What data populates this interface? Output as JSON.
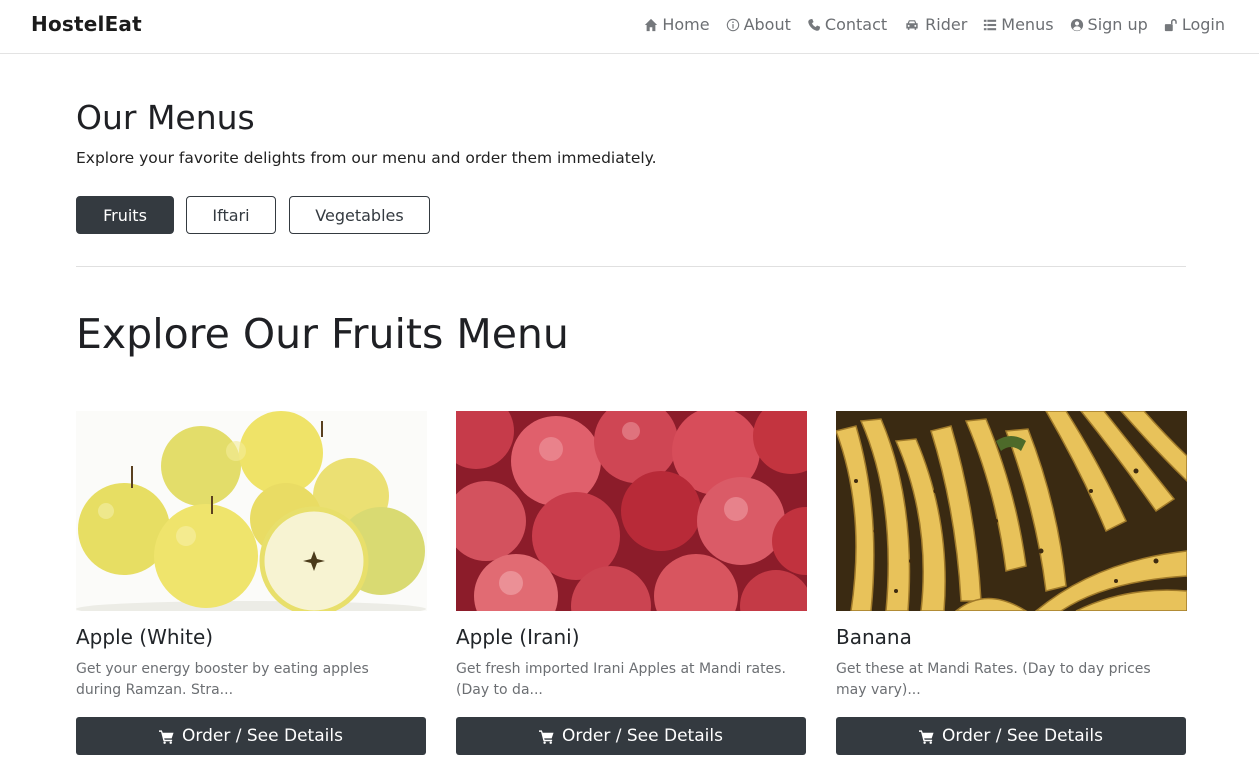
{
  "navbar": {
    "brand": "HostelEat",
    "items": [
      {
        "label": "Home",
        "icon": "home-icon"
      },
      {
        "label": "About",
        "icon": "info-icon"
      },
      {
        "label": "Contact",
        "icon": "phone-icon"
      },
      {
        "label": "Rider",
        "icon": "car-icon"
      },
      {
        "label": "Menus",
        "icon": "list-icon"
      },
      {
        "label": "Sign up",
        "icon": "user-circle-icon"
      },
      {
        "label": "Login",
        "icon": "unlock-icon"
      }
    ]
  },
  "menus": {
    "title": "Our Menus",
    "subtitle": "Explore your favorite delights from our menu and order them immediately.",
    "categories": [
      "Fruits",
      "Iftari",
      "Vegetables"
    ],
    "active_category": "Fruits"
  },
  "explore": {
    "title": "Explore Our Fruits Menu"
  },
  "cards": [
    {
      "title": "Apple (White)",
      "description": "Get your energy booster by eating apples during Ramzan. Stra...",
      "button": "Order / See Details",
      "image": "yellow-apples-photo"
    },
    {
      "title": "Apple (Irani)",
      "description": "Get fresh imported Irani Apples at Mandi rates. (Day to da...",
      "button": "Order / See Details",
      "image": "red-apples-photo"
    },
    {
      "title": "Banana",
      "description": "Get these at Mandi Rates. (Day to day prices may vary)...",
      "button": "Order / See Details",
      "image": "bananas-photo"
    }
  ],
  "colors": {
    "dark_button": "#343a40",
    "nav_text": "#6c6f73",
    "muted_text": "#6c6f73"
  }
}
